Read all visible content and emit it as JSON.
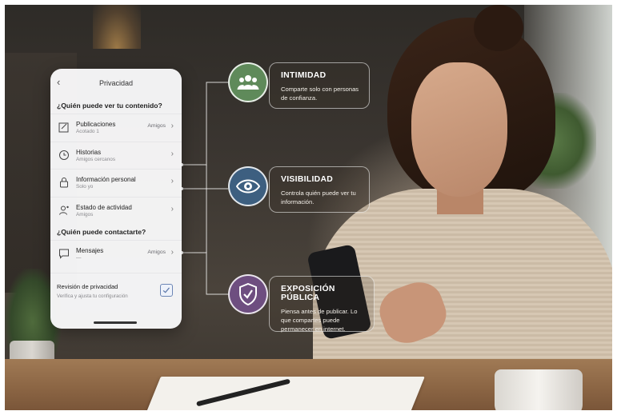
{
  "panel": {
    "title": "Privacidad",
    "section1": "¿Quién puede ver tu contenido?",
    "rows1": [
      {
        "label": "Publicaciones",
        "sub": "Acotado 1",
        "value": "Amigos"
      },
      {
        "label": "Historias",
        "sub": "Amigos cercanos",
        "value": ""
      },
      {
        "label": "Información personal",
        "sub": "Solo yo",
        "value": ""
      },
      {
        "label": "Estado de actividad",
        "sub": "Amigos",
        "value": ""
      }
    ],
    "section2": "¿Quién puede contactarte?",
    "rows2": [
      {
        "label": "Mensajes",
        "sub": "—",
        "value": "Amigos"
      }
    ],
    "review": {
      "label": "Revisión de privacidad",
      "sub": "Verifica y ajusta tu configuración"
    }
  },
  "cards": [
    {
      "title": "INTIMIDAD",
      "desc": "Comparte solo con personas de confianza.",
      "color": "#5f8a5a",
      "icon": "people-icon"
    },
    {
      "title": "VISIBILIDAD",
      "desc": "Controla quién puede ver tu información.",
      "color": "#3d5f80",
      "icon": "eye-icon"
    },
    {
      "title": "EXPOSICIÓN PÚBLICA",
      "desc": "Piensa antes de publicar. Lo que compartes puede permanecer en internet.",
      "color": "#6e4e80",
      "icon": "shield-icon"
    }
  ]
}
